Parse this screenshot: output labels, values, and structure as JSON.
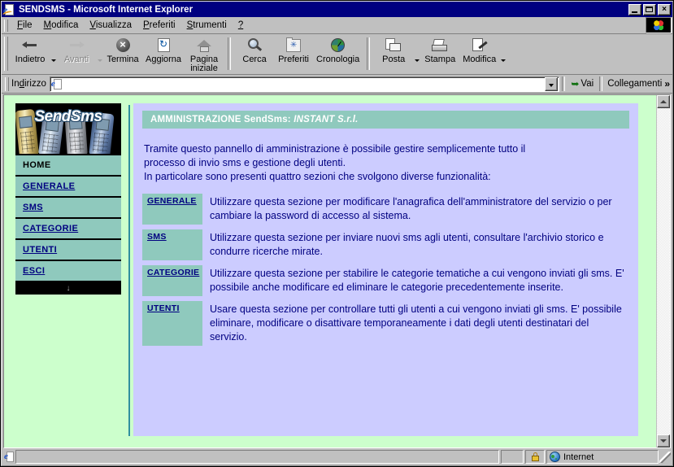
{
  "window": {
    "title": "SENDSMS - Microsoft Internet Explorer",
    "minimize_label": "_",
    "maximize_label": "□",
    "close_label": "×"
  },
  "menu": {
    "items": [
      {
        "label": "File",
        "accel": "F"
      },
      {
        "label": "Modifica",
        "accel": "M"
      },
      {
        "label": "Visualizza",
        "accel": "V"
      },
      {
        "label": "Preferiti",
        "accel": "P"
      },
      {
        "label": "Strumenti",
        "accel": "S"
      },
      {
        "label": "?",
        "accel": ""
      }
    ]
  },
  "toolbar": {
    "buttons": [
      {
        "label": "Indietro",
        "icon": "back-arrow-icon",
        "dropdown": true,
        "disabled": false
      },
      {
        "label": "Avanti",
        "icon": "forward-arrow-icon",
        "dropdown": true,
        "disabled": true
      },
      {
        "label": "Termina",
        "icon": "stop-icon",
        "dropdown": false,
        "disabled": false
      },
      {
        "label": "Aggiorna",
        "icon": "refresh-icon",
        "dropdown": false,
        "disabled": false
      },
      {
        "label": "Pagina\niniziale",
        "icon": "home-icon",
        "dropdown": false,
        "disabled": false
      },
      {
        "label": "Cerca",
        "icon": "search-icon",
        "dropdown": false,
        "disabled": false
      },
      {
        "label": "Preferiti",
        "icon": "favorites-folder-icon",
        "dropdown": false,
        "disabled": false
      },
      {
        "label": "Cronologia",
        "icon": "history-clock-icon",
        "dropdown": false,
        "disabled": false
      },
      {
        "label": "Posta",
        "icon": "mail-icon",
        "dropdown": true,
        "disabled": false
      },
      {
        "label": "Stampa",
        "icon": "printer-icon",
        "dropdown": false,
        "disabled": false
      },
      {
        "label": "Modifica",
        "icon": "edit-page-icon",
        "dropdown": true,
        "disabled": false
      }
    ]
  },
  "address_bar": {
    "label": "Indirizzo",
    "value": "",
    "placeholder": "",
    "go_label": "Vai",
    "links_label": "Collegamenti",
    "links_chevron": "»"
  },
  "sidebar": {
    "logo_text": "SendSms",
    "items": [
      {
        "label": "HOME",
        "current": true
      },
      {
        "label": "GENERALE",
        "current": false
      },
      {
        "label": "SMS",
        "current": false
      },
      {
        "label": "CATEGORIE",
        "current": false
      },
      {
        "label": "UTENTI",
        "current": false
      },
      {
        "label": "ESCI",
        "current": false
      }
    ],
    "bottom_arrow": "↓"
  },
  "main": {
    "header_prefix": "AMMINISTRAZIONE SendSms: ",
    "header_company": "INSTANT S.r.l.",
    "intro_line1": "Tramite questo pannello di amministrazione è possibile gestire semplicemente tutto il",
    "intro_line2": "processo di invio sms e gestione degli utenti.",
    "intro_line3": "In particolare sono presenti quattro sezioni che svolgono diverse funzionalità:",
    "sections": [
      {
        "label": "GENERALE",
        "description": "Utilizzare questa sezione per modificare l'anagrafica dell'amministratore del servizio o per cambiare la password di accesso al sistema."
      },
      {
        "label": "SMS",
        "description": "Utilizzare questa sezione per inviare nuovi sms agli utenti, consultare l'archivio storico e condurre ricerche mirate."
      },
      {
        "label": "CATEGORIE",
        "description": "Utilizzare questa sezione per stabilire le categorie tematiche a cui vengono inviati gli sms.\nE' possibile anche modificare ed eliminare le categorie precedentemente inserite."
      },
      {
        "label": "UTENTI",
        "description": "Usare questa sezione per controllare tutti gli utenti a cui vengono inviati gli sms.\nE' possibile eliminare, modificare o disattivare temporaneamente i dati degli utenti destinatari del servizio."
      }
    ]
  },
  "status_bar": {
    "message": "",
    "zone_label": "Internet"
  },
  "colors": {
    "page_background": "#ccffcc",
    "panel_background": "#ccccff",
    "accent_teal": "#8fc9bd",
    "link_navy": "#000080",
    "titlebar_blue": "#000080",
    "chrome_gray": "#c0c0c0"
  }
}
